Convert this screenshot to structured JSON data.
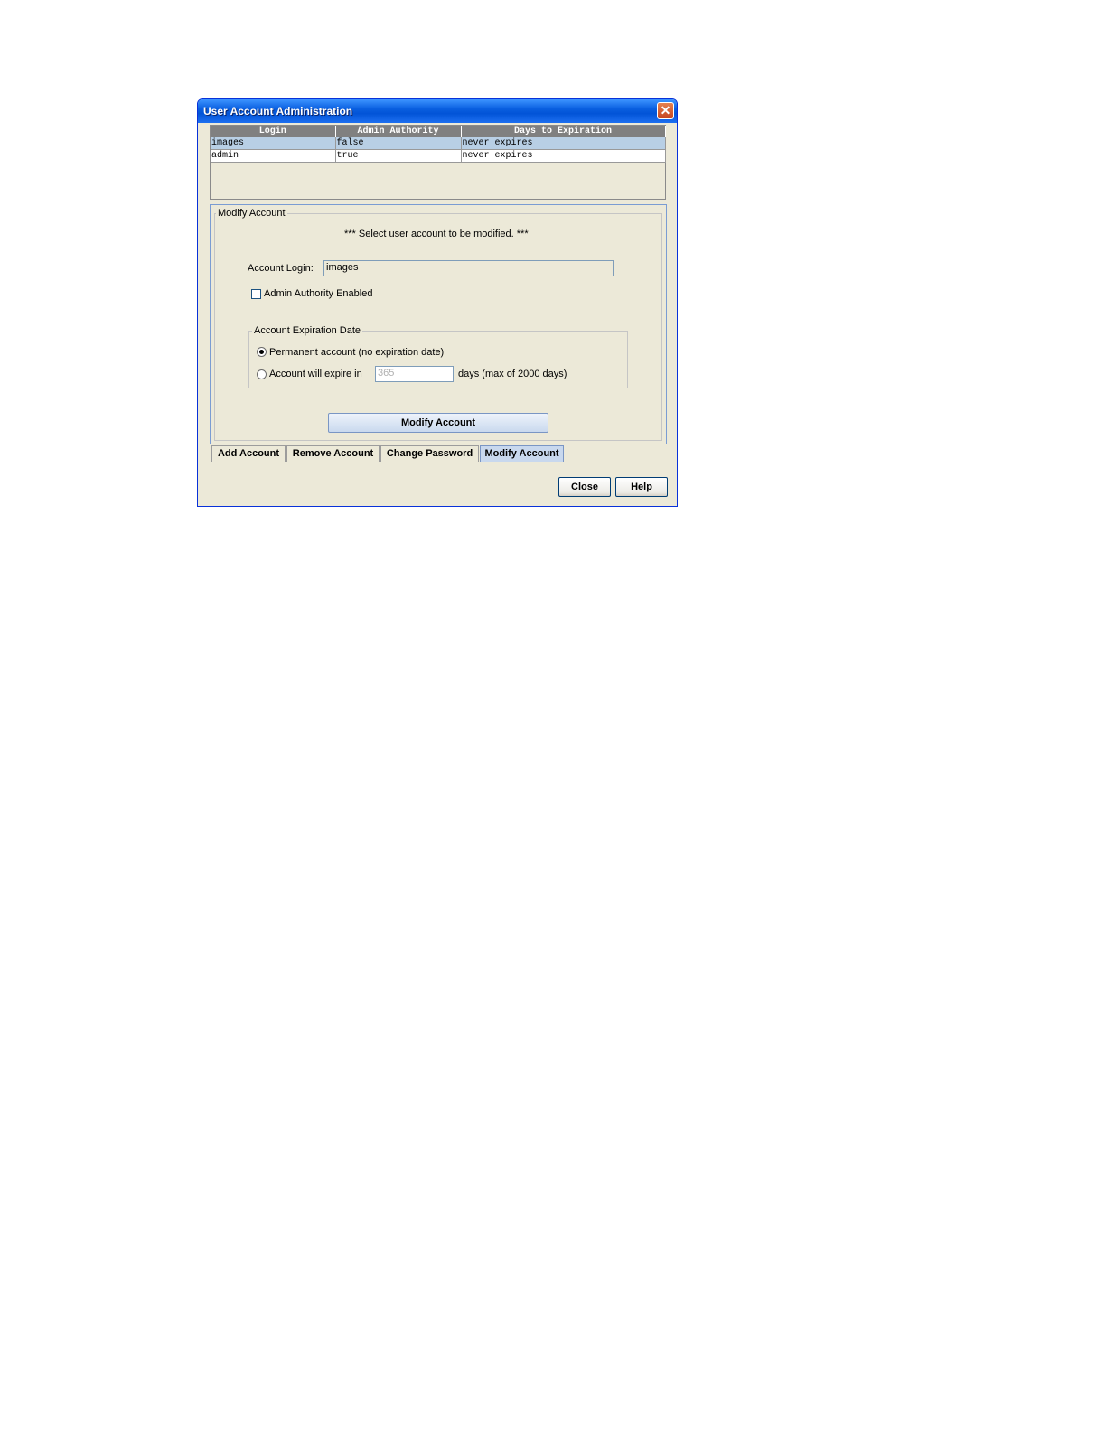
{
  "window": {
    "title": "User Account Administration",
    "close_glyph": "✕"
  },
  "table": {
    "columns": [
      "Login",
      "Admin Authority",
      "Days to Expiration"
    ],
    "rows": [
      {
        "login": "images",
        "admin": "false",
        "days": "never expires",
        "selected": true
      },
      {
        "login": "admin",
        "admin": "true",
        "days": "never expires",
        "selected": false
      }
    ]
  },
  "modify_panel": {
    "title": "Modify Account",
    "instruction": "*** Select user account to be modified. ***",
    "login_label": "Account Login:",
    "login_value": "images",
    "admin_checkbox_label": "Admin Authority Enabled",
    "admin_checked": false,
    "expiration": {
      "title": "Account Expiration Date",
      "permanent_label": "Permanent account (no expiration date)",
      "permanent_selected": true,
      "expire_label": "Account will expire in",
      "expire_days_value": "365",
      "expire_suffix": "days (max of 2000 days)"
    },
    "modify_button": "Modify Account"
  },
  "tabs": [
    {
      "label": "Add Account",
      "active": false
    },
    {
      "label": "Remove Account",
      "active": false
    },
    {
      "label": "Change Password",
      "active": false
    },
    {
      "label": "Modify Account",
      "active": true
    }
  ],
  "footer": {
    "close_label": "Close",
    "help_label": "Help"
  },
  "colors": {
    "title_bar": "#0a5fe0",
    "selected_row": "#b8cfe5",
    "window_bg": "#ece9d8"
  }
}
